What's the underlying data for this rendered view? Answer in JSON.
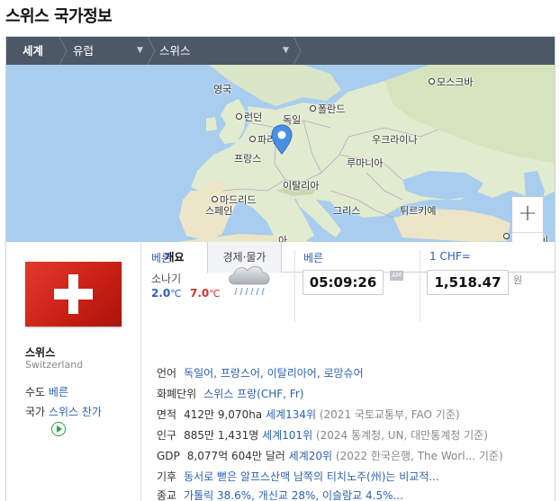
{
  "page": {
    "title": "스위스 국가정보"
  },
  "breadcrumb": [
    {
      "label": "세계"
    },
    {
      "label": "유럽"
    },
    {
      "label": "스위스"
    }
  ],
  "map": {
    "labels": {
      "uk": "영국",
      "moscow": "모스크바",
      "london": "런던",
      "germany": "독일",
      "poland": "폴란드",
      "paris": "파리",
      "ukraine": "우크라이나",
      "france": "프랑스",
      "romania": "루마니아",
      "madrid": "마드리드",
      "italy": "이탈리아",
      "spain": "스페인",
      "greece": "그리스",
      "turkey": "튀르키예",
      "tehran": "테헤란",
      "cut1": "아",
      "cut2": "이"
    },
    "zoom_in": "+",
    "zoom_out": "−"
  },
  "country": {
    "name": "스위스",
    "name_en": "Switzerland",
    "capital_label": "수도",
    "capital": "베른",
    "anthem_label": "국가",
    "anthem": "스위스 찬가"
  },
  "tabs": [
    {
      "label": "개요",
      "active": true
    },
    {
      "label": "경제·물가",
      "active": false
    }
  ],
  "weather": {
    "city": "베른",
    "condition": "소나기",
    "low": "2.0",
    "high": "7.0",
    "unit": "℃"
  },
  "clock": {
    "city": "베른",
    "time": "05:09:26",
    "ampm": "AM"
  },
  "fx": {
    "label": "1 CHF=",
    "value": "1,518.47",
    "unit": "원"
  },
  "info": {
    "language": {
      "key": "언어",
      "value": "독일어, 프랑스어, 이탈리아어, 로망슈어"
    },
    "currency": {
      "key": "화폐단위",
      "value": "스위스 프랑(CHF, Fr)"
    },
    "area": {
      "key": "면적",
      "value": "412만 9,070ha",
      "rank": "세계134위",
      "source": "(2021 국토교통부, FAO 기준)"
    },
    "population": {
      "key": "인구",
      "value": "885만 1,431명",
      "rank": "세계101위",
      "source": "(2024 통계청, UN, 대만통계청 기준)"
    },
    "gdp": {
      "key": "GDP",
      "value": "8,077억 604만 달러",
      "rank": "세계20위",
      "source": "(2022 한국은행, The Worl...  기준)"
    },
    "climate": {
      "key": "기후",
      "value": "동서로 뻗은 알프스산맥 남쪽의 티치노주(州)는 비교적..."
    },
    "religion": {
      "key": "종교",
      "value": "가톨릭 38.6%, 개신교 28%, 이슬람교 4.5%..."
    }
  }
}
